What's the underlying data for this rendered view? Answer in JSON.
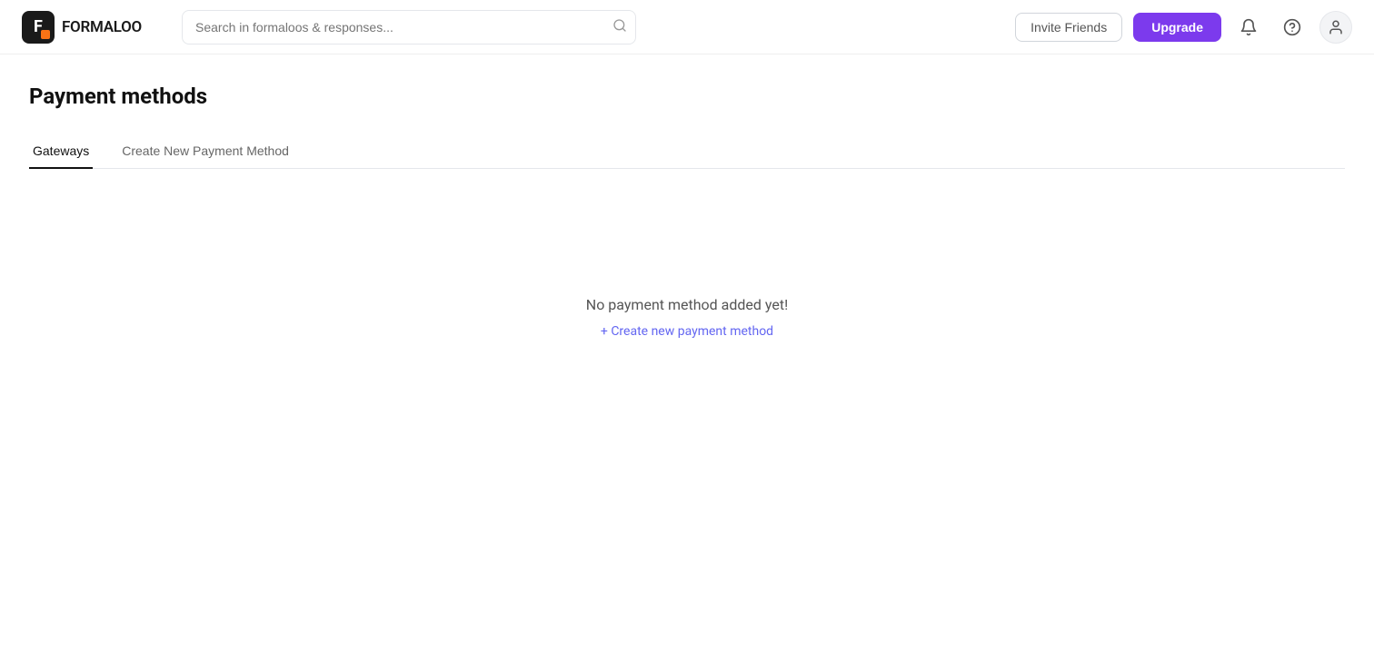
{
  "header": {
    "logo_text": "FORMALOO",
    "search_placeholder": "Search in formaloos & responses...",
    "invite_label": "Invite Friends",
    "upgrade_label": "Upgrade"
  },
  "page": {
    "title": "Payment methods"
  },
  "tabs": [
    {
      "id": "gateways",
      "label": "Gateways",
      "active": true
    },
    {
      "id": "create-new",
      "label": "Create New Payment Method",
      "active": false
    }
  ],
  "empty_state": {
    "message": "No payment method added yet!",
    "cta": "+ Create new payment method"
  },
  "icons": {
    "search": "🔍",
    "bell": "🔔",
    "help": "❓",
    "user": "👤"
  }
}
